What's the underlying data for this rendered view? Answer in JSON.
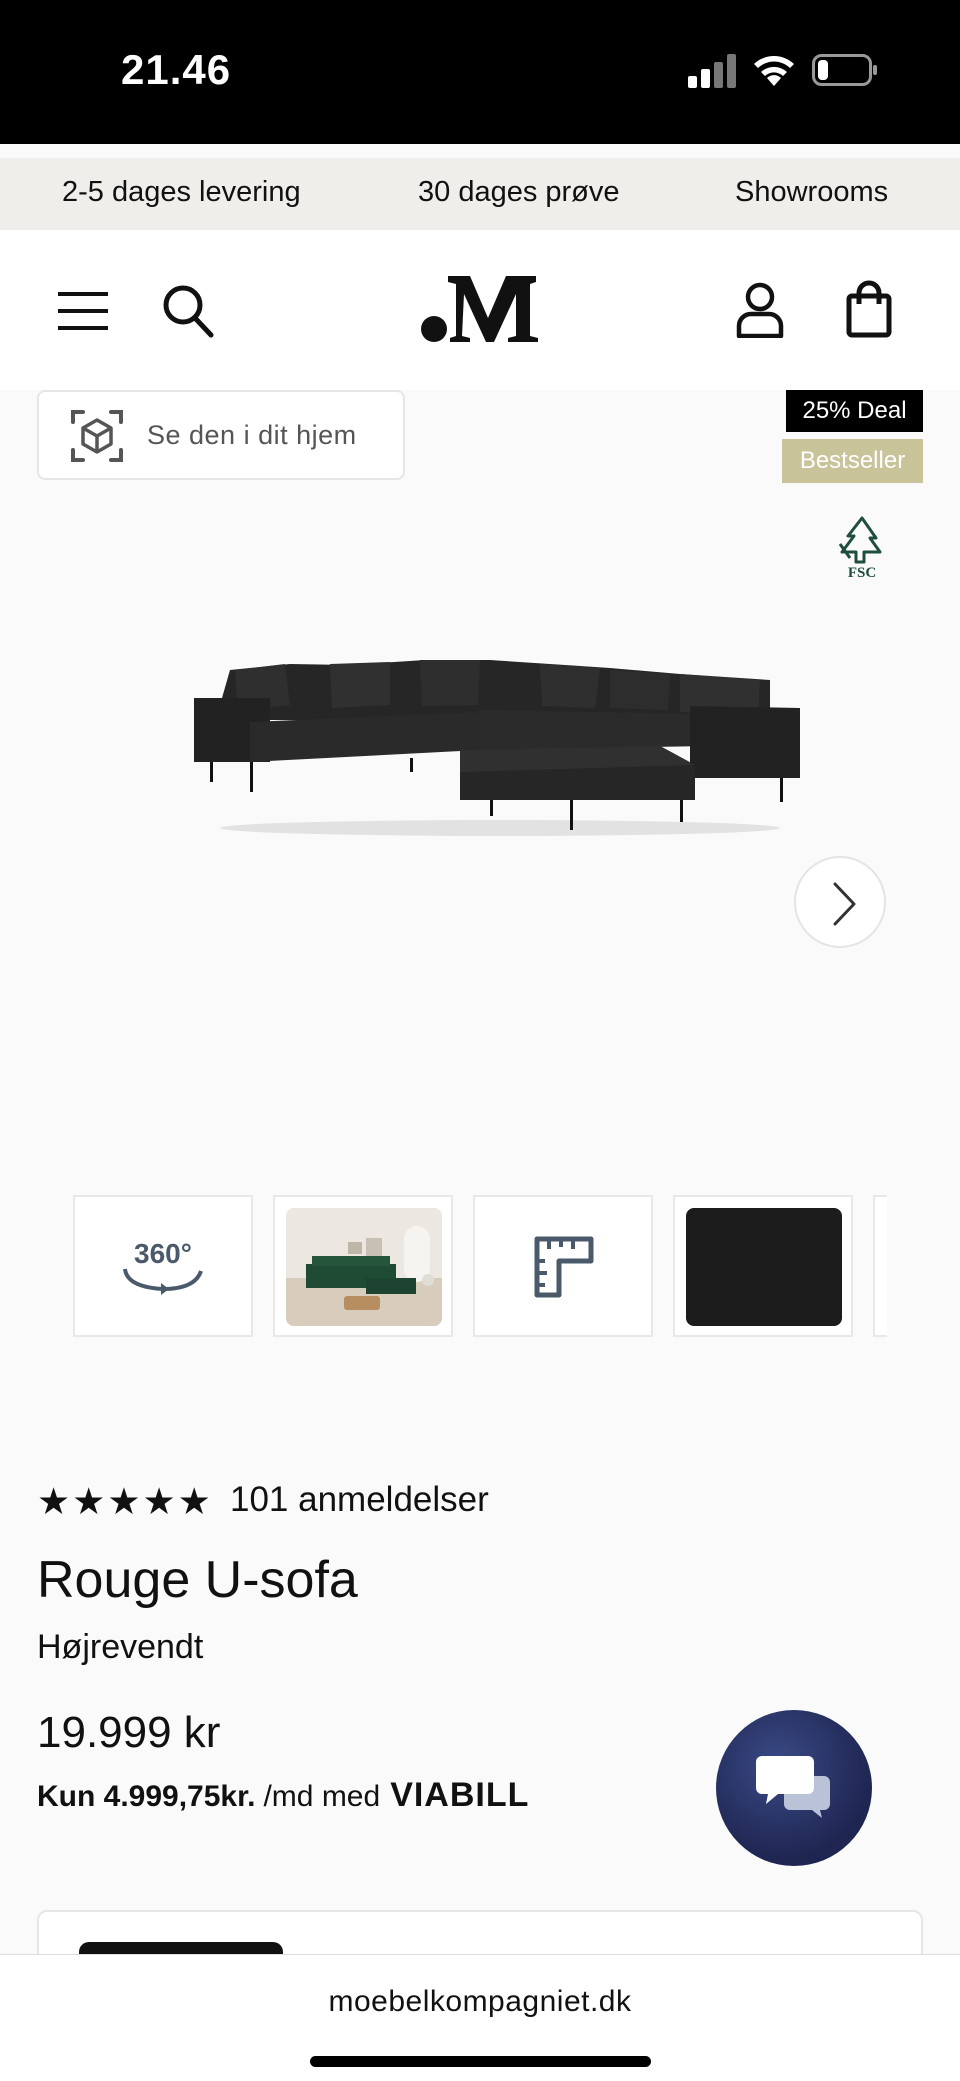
{
  "status_bar": {
    "time": "21.46"
  },
  "usp_bar": {
    "items": [
      "2-5 dages levering",
      "30 dages prøve",
      "Showrooms"
    ]
  },
  "header": {
    "logo_text": ".M",
    "menu_icon": "hamburger-icon",
    "search_icon": "search-icon",
    "account_icon": "user-icon",
    "cart_icon": "shopping-bag-icon"
  },
  "gallery": {
    "ar_button_label": "Se den i dit hjem",
    "badges": [
      "25% Deal",
      "Bestseller"
    ],
    "fsc_label": "FSC",
    "thumbnails": [
      {
        "type": "360",
        "label": "360°"
      },
      {
        "type": "room-photo"
      },
      {
        "type": "dimensions"
      },
      {
        "type": "fabric-swatch"
      }
    ]
  },
  "product": {
    "stars": "★★★★★",
    "rating": 5,
    "reviews": "101 anmeldelser",
    "title": "Rouge U-sofa",
    "variant": "Højrevendt",
    "price": "19.999 kr",
    "finance_amount": "Kun 4.999,75kr.",
    "finance_suffix": "/md med",
    "finance_brand": "VIABILL"
  },
  "browser": {
    "url": "moebelkompagniet.dk"
  },
  "colors": {
    "deal_badge": "#000000",
    "bestseller_badge": "#c9c39a",
    "chat_button": "#26305f",
    "usp_bar": "#efeeea"
  }
}
